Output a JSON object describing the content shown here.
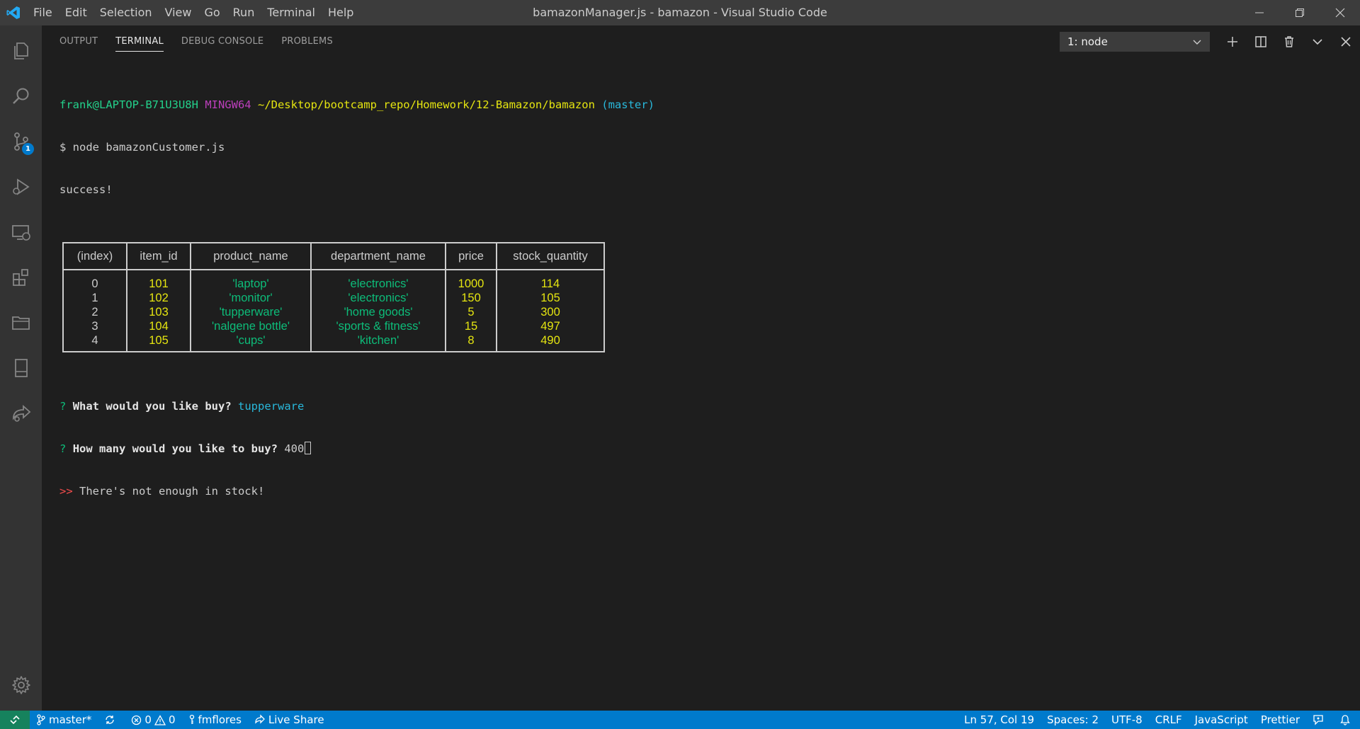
{
  "window": {
    "title": "bamazonManager.js - bamazon - Visual Studio Code",
    "menu": [
      "File",
      "Edit",
      "Selection",
      "View",
      "Go",
      "Run",
      "Terminal",
      "Help"
    ]
  },
  "activity_bar": {
    "items": [
      "explorer-icon",
      "search-icon",
      "source-control-icon",
      "run-debug-icon",
      "remote-explorer-icon",
      "extensions-icon",
      "folder-icon",
      "notebook-icon",
      "live-share-icon"
    ],
    "source_control_badge": "1",
    "settings": "gear-icon"
  },
  "panel": {
    "tabs": [
      "OUTPUT",
      "TERMINAL",
      "DEBUG CONSOLE",
      "PROBLEMS"
    ],
    "active_tab": "TERMINAL",
    "terminal_select": "1: node"
  },
  "terminal": {
    "prompt_user": "frank@LAPTOP-B71U3U8H",
    "prompt_env": "MINGW64",
    "prompt_path": "~/Desktop/bootcamp_repo/Homework/12-Bamazon/bamazon",
    "prompt_branch": "(master)",
    "command": "$ node bamazonCustomer.js",
    "success": "success!",
    "table": {
      "headers": [
        "(index)",
        "item_id",
        "product_name",
        "department_name",
        "price",
        "stock_quantity"
      ],
      "rows": [
        [
          "0",
          "101",
          "'laptop'",
          "'electronics'",
          "1000",
          "114"
        ],
        [
          "1",
          "102",
          "'monitor'",
          "'electronics'",
          "150",
          "105"
        ],
        [
          "2",
          "103",
          "'tupperware'",
          "'home goods'",
          "5",
          "300"
        ],
        [
          "3",
          "104",
          "'nalgene bottle'",
          "'sports & fitness'",
          "15",
          "497"
        ],
        [
          "4",
          "105",
          "'cups'",
          "'kitchen'",
          "8",
          "490"
        ]
      ]
    },
    "q1_mark": "?",
    "q1_text": "What would you like buy?",
    "q1_answer": "tupperware",
    "q2_mark": "?",
    "q2_text": "How many would you like to buy?",
    "q2_answer": "400",
    "error_mark": ">>",
    "error_text": "There's not enough in stock!"
  },
  "status_bar": {
    "branch": "master*",
    "errors": "0",
    "warnings": "0",
    "user": "fmflores",
    "live_share": "Live Share",
    "cursor": "Ln 57, Col 19",
    "spaces": "Spaces: 2",
    "encoding": "UTF-8",
    "eol": "CRLF",
    "language": "JavaScript",
    "formatter": "Prettier"
  },
  "colors": {
    "accent": "#007acc",
    "remote": "#16825d",
    "titlebar": "#3c3c3c",
    "activitybar": "#333333",
    "editor_bg": "#1e1e1e"
  }
}
